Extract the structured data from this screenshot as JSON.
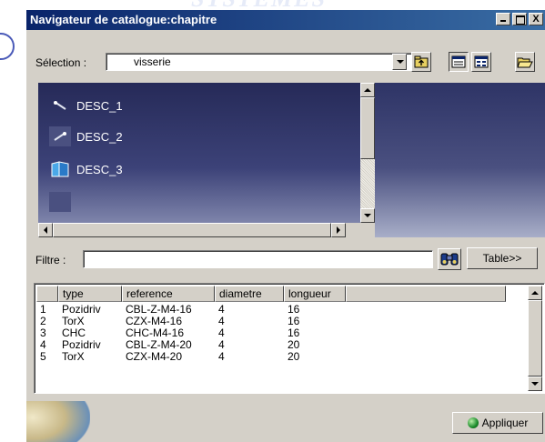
{
  "background_text": "SYSTÈMES",
  "window": {
    "title": "Navigateur de catalogue:chapitre",
    "close_glyph": "X"
  },
  "selection": {
    "label": "Sélection :",
    "value": "visserie"
  },
  "tree": {
    "items": [
      {
        "label": "DESC_1",
        "icon": "screw-icon"
      },
      {
        "label": "DESC_2",
        "icon": "screw-icon"
      },
      {
        "label": "DESC_3",
        "icon": "book-icon"
      },
      {
        "label": "",
        "icon": "placeholder-icon"
      }
    ]
  },
  "filter": {
    "label": "Filtre :",
    "value": ""
  },
  "table_button": "Table>>",
  "table": {
    "columns": [
      "",
      "type",
      "reference",
      "diametre",
      "longueur"
    ],
    "rows": [
      [
        "1",
        "Pozidriv",
        "CBL-Z-M4-16",
        "4",
        "16"
      ],
      [
        "2",
        "TorX",
        "CZX-M4-16",
        "4",
        "16"
      ],
      [
        "3",
        "CHC",
        "CHC-M4-16",
        "4",
        "16"
      ],
      [
        "4",
        "Pozidriv",
        "CBL-Z-M4-20",
        "4",
        "20"
      ],
      [
        "5",
        "TorX",
        "CZX-M4-20",
        "4",
        "20"
      ]
    ]
  },
  "apply_button": "Appliquer",
  "colors": {
    "titlebar_start": "#0a246a",
    "titlebar_end": "#3a6ea5",
    "face": "#d4d0c8",
    "tree_bg": "#262a58"
  }
}
